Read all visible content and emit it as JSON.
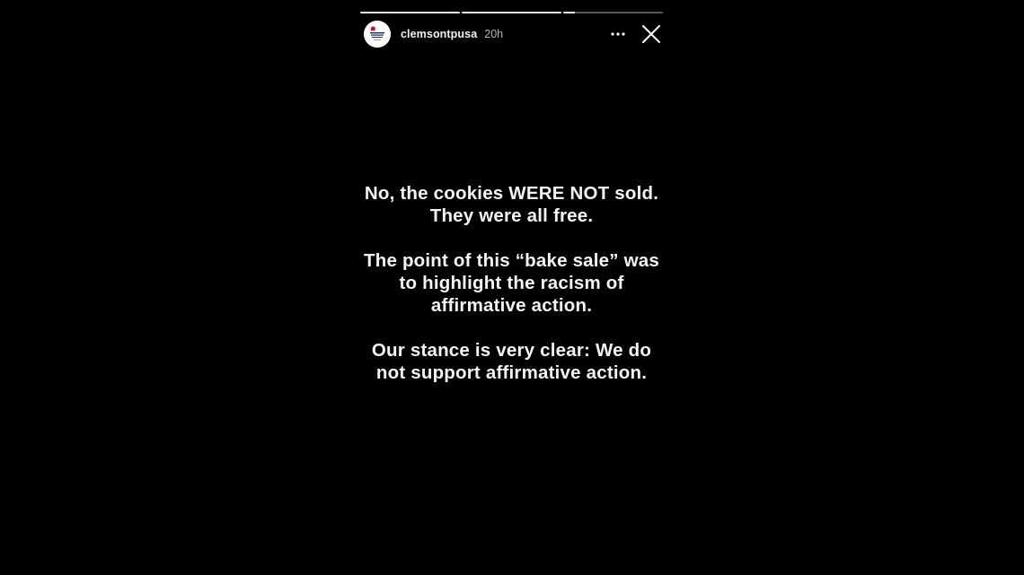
{
  "progress": {
    "segments": [
      {
        "fill": 1.0
      },
      {
        "fill": 1.0
      },
      {
        "fill": 0.12
      }
    ]
  },
  "header": {
    "username": "clemsontpusa",
    "timestamp": "20h",
    "avatar_icon": "turning-point-logo-icon",
    "more_icon": "more-options-icon",
    "close_icon": "close-icon"
  },
  "story": {
    "paragraphs": [
      {
        "lines": [
          "No, the cookies WERE NOT sold.",
          "They were all free."
        ]
      },
      {
        "lines": [
          "The point of this “bake sale” was",
          "to highlight the racism of",
          "affirmative action."
        ]
      },
      {
        "lines": [
          "Our stance is very clear: We do",
          "not support affirmative action."
        ]
      }
    ]
  },
  "colors": {
    "background": "#000000",
    "text": "#f4f4f4",
    "timestamp": "#b5b5b5"
  }
}
